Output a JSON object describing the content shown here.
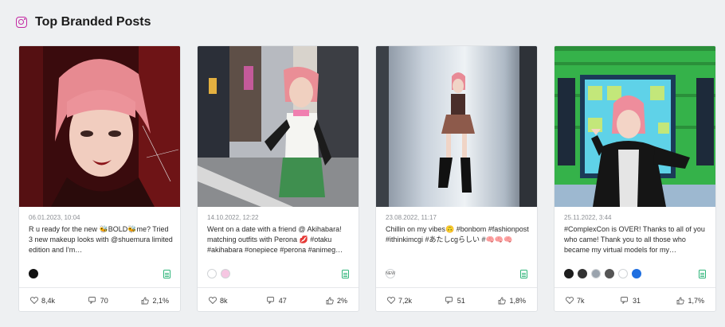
{
  "section": {
    "title": "Top Branded Posts",
    "icon": "instagram-icon"
  },
  "colors": {
    "instagram_accent": "#c32aa3",
    "report_green": "#2fb57a"
  },
  "posts": [
    {
      "date": "06.01.2023, 10:04",
      "caption": "R u ready for the new 🐝BOLD🐝me? Tried 3 new makeup looks with @shuemura limited edition and I'm…",
      "avatars": [
        ""
      ],
      "likes": "8,4k",
      "comments": "70",
      "engagement": "2,1%"
    },
    {
      "date": "14.10.2022, 12:22",
      "caption": "Went on a date with a friend @ Akihabara! matching outfits with Perona 💋 #otaku #akihabara #onepiece #perona #animeg…",
      "avatars": [
        "",
        ""
      ],
      "likes": "8k",
      "comments": "47",
      "engagement": "2%"
    },
    {
      "date": "23.08.2022, 11:17",
      "caption": "Chillin on my vibes🙃 #bonbom #fashionpost #ithinkimcgi #あたしcgらしい #🧠🧠🧠",
      "avatars": [
        "NEW"
      ],
      "likes": "7,2k",
      "comments": "51",
      "engagement": "1,8%"
    },
    {
      "date": "25.11.2022, 3:44",
      "caption": "#ComplexCon is OVER! Thanks to all of you who came! Thank you to all those who became my virtual models for my…",
      "avatars": [
        "",
        "",
        "",
        "",
        "",
        ""
      ],
      "likes": "7k",
      "comments": "31",
      "engagement": "1,7%"
    }
  ]
}
